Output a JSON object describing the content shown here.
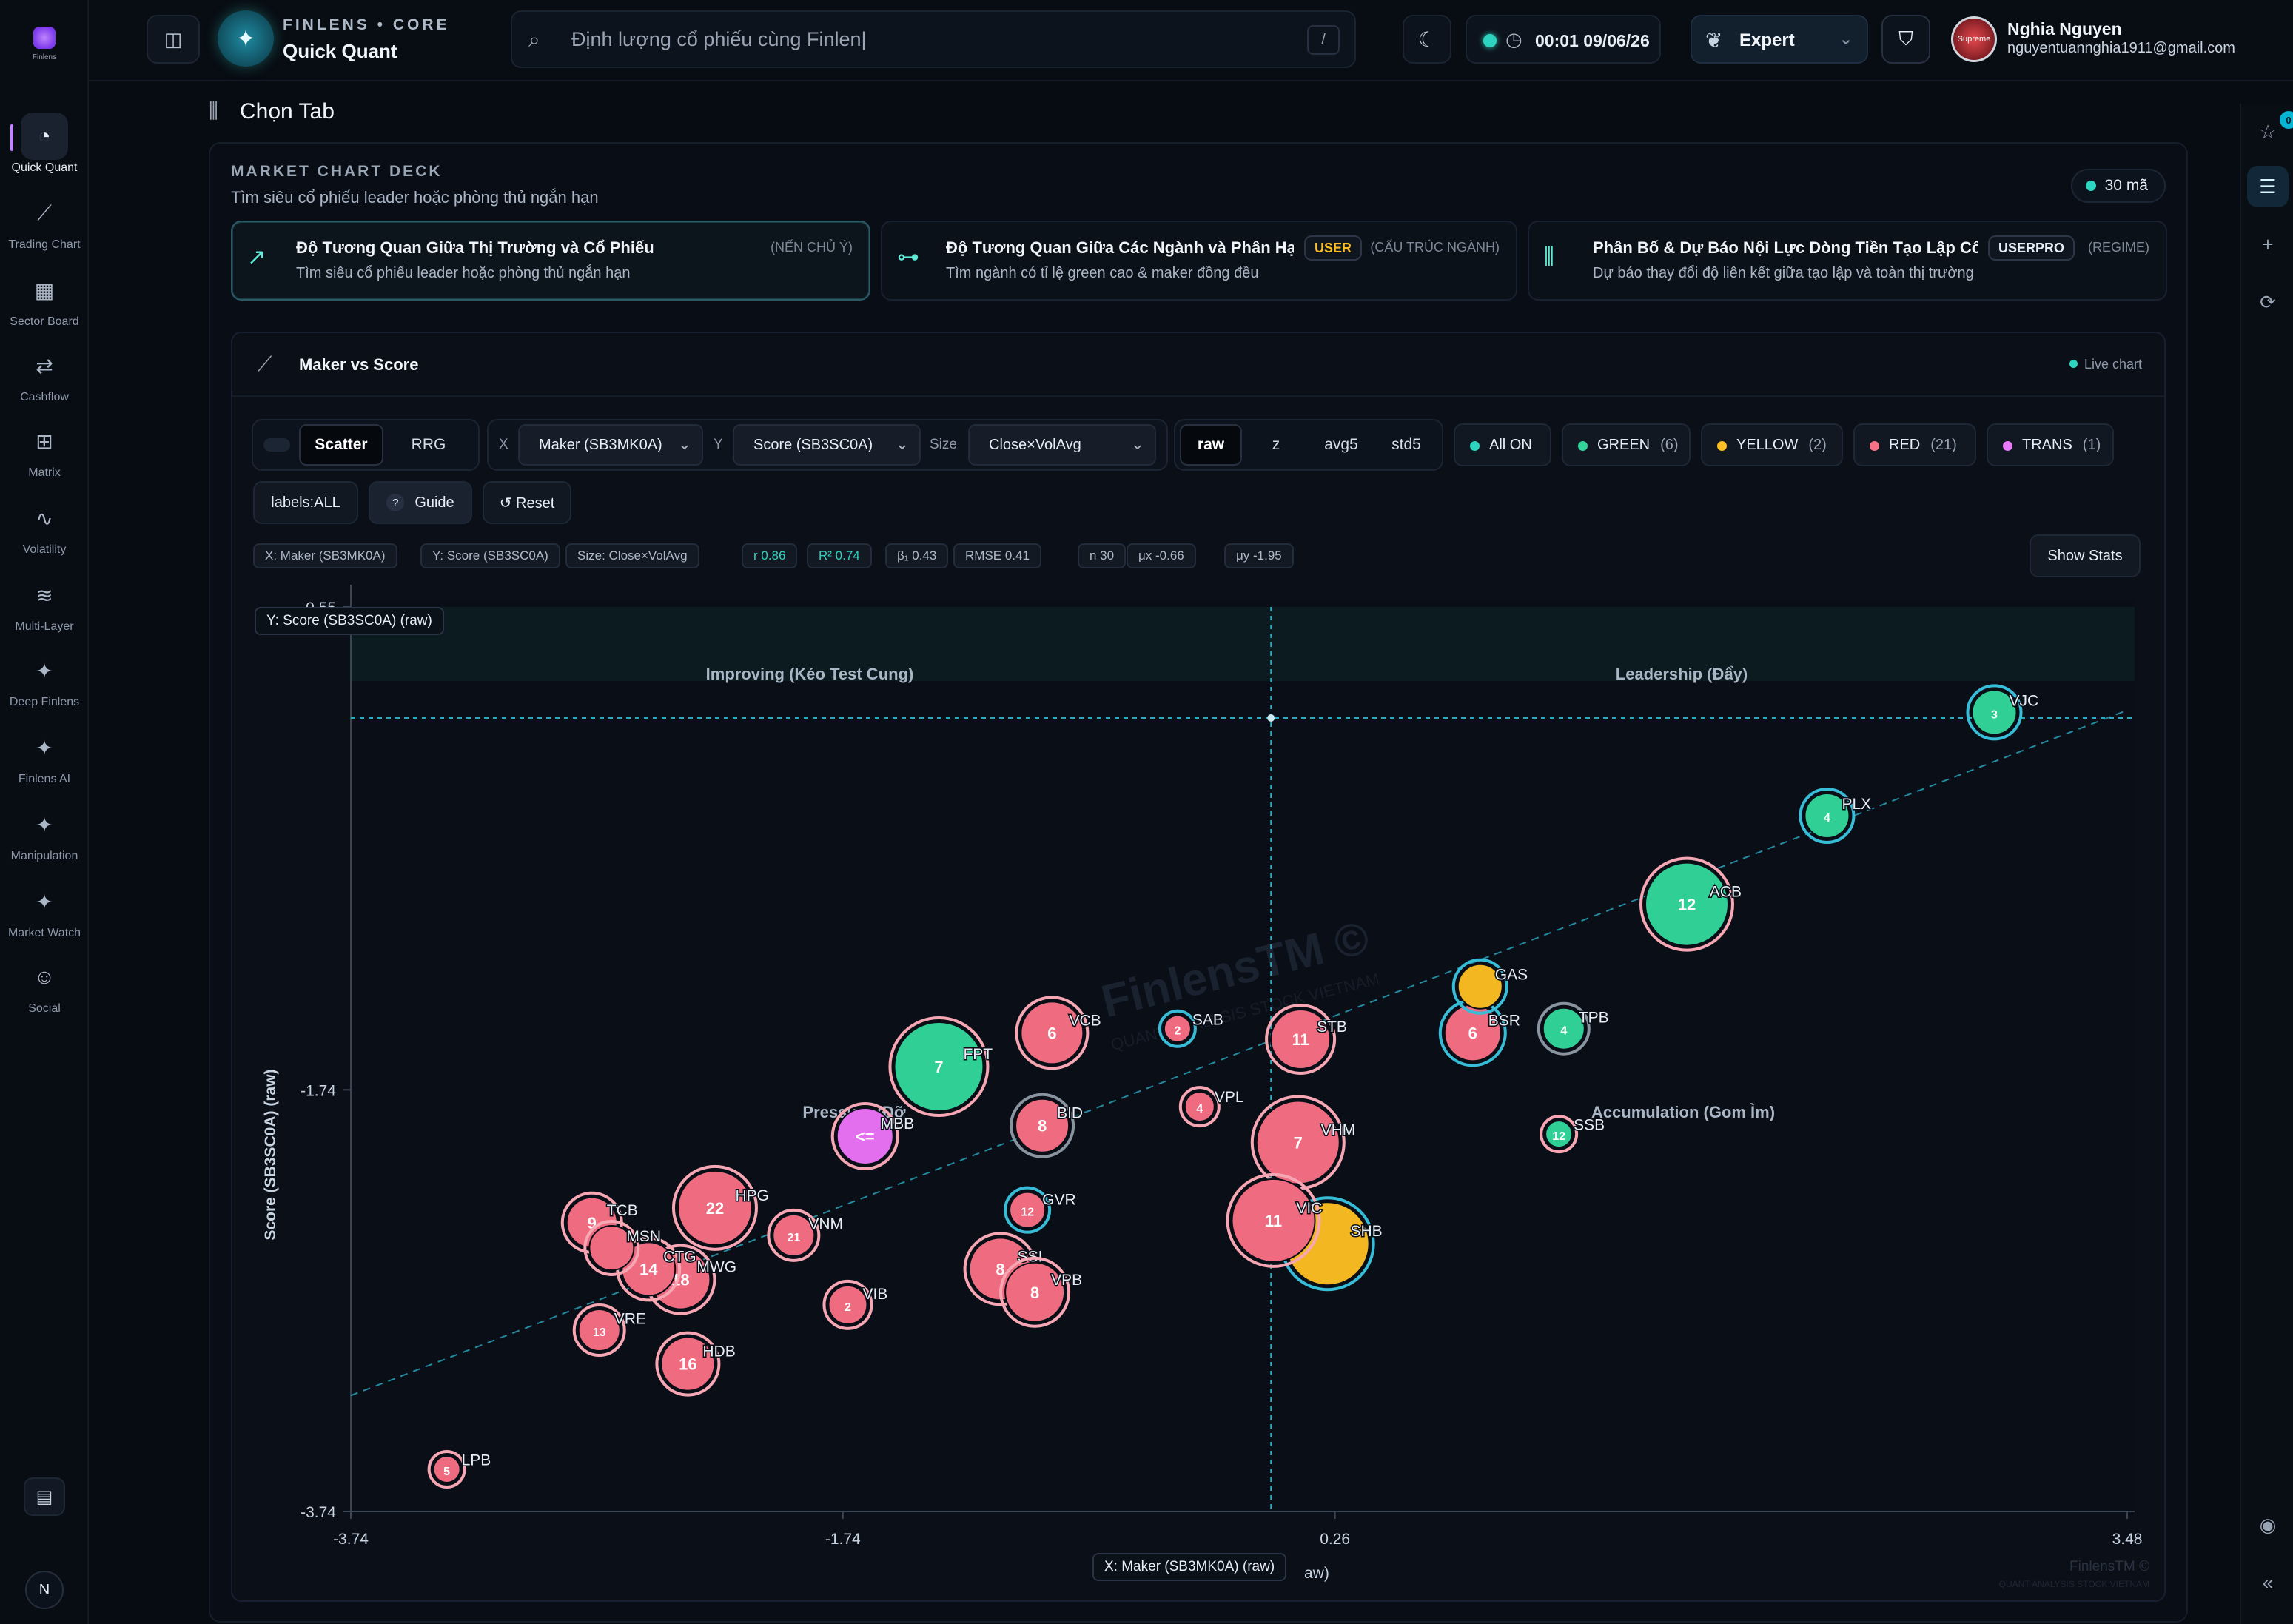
{
  "sidebar": {
    "logo_text": "Finlens",
    "items": [
      {
        "label": "Quick Quant",
        "icon": "gauge-icon",
        "glyph": "◔",
        "active": true
      },
      {
        "label": "Trading Chart",
        "icon": "line-chart-icon",
        "glyph": "⟋",
        "active": false
      },
      {
        "label": "Sector Board",
        "icon": "blocks-icon",
        "glyph": "▦",
        "active": false
      },
      {
        "label": "Cashflow",
        "icon": "arrows-swap-icon",
        "glyph": "⇄",
        "active": false
      },
      {
        "label": "Matrix",
        "icon": "grid-icon",
        "glyph": "⊞",
        "active": false
      },
      {
        "label": "Volatility",
        "icon": "pulse-icon",
        "glyph": "∿",
        "active": false
      },
      {
        "label": "Multi-Layer",
        "icon": "layers-icon",
        "glyph": "≋",
        "active": false
      },
      {
        "label": "Deep Finlens",
        "icon": "sparkles-icon",
        "glyph": "✦",
        "active": false
      },
      {
        "label": "Finlens AI",
        "icon": "sparkles-icon",
        "glyph": "✦",
        "active": false
      },
      {
        "label": "Manipulation",
        "icon": "sparkles-icon",
        "glyph": "✦",
        "active": false
      },
      {
        "label": "Market Watch",
        "icon": "sparkles-icon",
        "glyph": "✦",
        "active": false
      },
      {
        "label": "Social",
        "icon": "users-icon",
        "glyph": "☺",
        "active": false
      }
    ],
    "book_glyph": "▤",
    "user_initial": "N"
  },
  "topbar": {
    "brand_top": "FINLENS • CORE",
    "brand_name": "Quick Quant",
    "search_value": "Định lượng cổ phiếu cùng Finlen|",
    "search_shortcut": "/",
    "time": "00:01 09/06/26",
    "mode": "Expert",
    "user_name": "Nghia Nguyen",
    "user_email": "nguyentuannghia1911@gmail.com",
    "avatar_text": "Supreme"
  },
  "rail": {
    "badge": "0"
  },
  "page": {
    "heading": "Chọn Tab"
  },
  "deck": {
    "kicker": "MARKET CHART DECK",
    "subtitle": "Tìm siêu cổ phiếu leader hoặc phòng thủ ngắn hạn",
    "count": "30 mã",
    "cards": [
      {
        "title": "Độ Tương Quan Giữa Thị Trường và Cổ Phiếu",
        "desc": "Tìm siêu cổ phiếu leader hoặc phòng thủ ngắn hạn",
        "tag": "(NẾN CHỦ Ý)",
        "badge": ""
      },
      {
        "title": "Độ Tương Quan Giữa Các Ngành và Phân Hạ...",
        "desc": "Tìm ngành có tỉ lệ green cao & maker đồng đều",
        "tag": "(CẤU TRÚC NGÀNH)",
        "badge": "USER"
      },
      {
        "title": "Phân Bố & Dự Báo Nội Lực Dòng Tiền Tạo Lập Cổ ...",
        "desc": "Dự báo thay đổi độ liên kết giữa tạo lập và toàn thị trường",
        "tag": "(REGIME)",
        "badge": "USERPRO"
      }
    ]
  },
  "chart_card": {
    "title": "Maker vs Score",
    "live": "Live chart",
    "mode_tabs": [
      "Scatter",
      "RRG"
    ],
    "x_label": "X",
    "x_select": "Maker (SB3MK0A)",
    "y_label": "Y",
    "y_select": "Score (SB3SC0A)",
    "size_label": "Size",
    "size_select": "Close×VolAvg",
    "transforms": [
      "raw",
      "z",
      "avg5",
      "std5"
    ],
    "filters": [
      {
        "label": "All ON",
        "count": "",
        "color": "#2dd4bf"
      },
      {
        "label": "GREEN",
        "count": "(6)",
        "color": "#34d399"
      },
      {
        "label": "YELLOW",
        "count": "(2)",
        "color": "#fbbf24"
      },
      {
        "label": "RED",
        "count": "(21)",
        "color": "#f87185"
      },
      {
        "label": "TRANS",
        "count": "(1)",
        "color": "#e879f9"
      }
    ],
    "labels_btn": "labels:ALL",
    "guide_btn": "Guide",
    "guide_icon": "?",
    "reset_btn": "↺ Reset",
    "stats_chips": [
      {
        "text": "X: Maker (SB3MK0A)",
        "teal": false
      },
      {
        "text": "Y: Score (SB3SC0A)",
        "teal": false
      },
      {
        "text": "Size: Close×VolAvg",
        "teal": false
      },
      {
        "text": "r 0.86",
        "teal": true
      },
      {
        "text": "R² 0.74",
        "teal": true
      },
      {
        "text": "β₁ 0.43",
        "teal": false
      },
      {
        "text": "RMSE 0.41",
        "teal": false
      },
      {
        "text": "n 30",
        "teal": false
      },
      {
        "text": "μx -0.66",
        "teal": false
      },
      {
        "text": "μy -1.95",
        "teal": false
      }
    ],
    "show_stats": "Show Stats",
    "y_badge": "Y: Score (SB3SC0A) (raw)",
    "x_badge": "X: Maker (SB3MK0A) (raw)",
    "x_axis_tail": "aw)",
    "watermark_line1": "FinlensTM ©",
    "watermark_line2": "QUANT ANALYSIS STOCK VIETNAM"
  },
  "chart_data": {
    "type": "scatter",
    "title": "Maker vs Score",
    "xlabel": "X: Maker (SB3MK0A) (raw)",
    "ylabel": "Score (SB3SC0A) (raw)",
    "xlim": [
      -3.74,
      3.48
    ],
    "ylim": [
      -3.74,
      0.55
    ],
    "x_ticks": [
      "-3.74",
      "-1.74",
      "0.26",
      "3.48"
    ],
    "y_ticks": [
      "0.55",
      "-1.74",
      "-3.74"
    ],
    "split_x": -0.0,
    "split_y": 0.0,
    "quadrants": [
      "Improving (Kéo Test Cung)",
      "Leadership (Đẩy)",
      "Pressure (Đỡ",
      "Accumulation (Gom Ìm)"
    ],
    "colors": {
      "GREEN": "#2fcf96",
      "YELLOW": "#f2b721",
      "RED": "#ee6b80",
      "TRANS": "#e46fee"
    },
    "rings": {
      "teal": "#38bdd8",
      "grey": "#8a93a0",
      "pink": "#f7a6b3"
    },
    "regression": {
      "x": [
        -3.74,
        3.48
      ],
      "y": [
        -3.19,
        0.06
      ]
    },
    "points": [
      {
        "t": "VJC",
        "x": 2.94,
        "y": 0.05,
        "n": "3",
        "c": "GREEN",
        "ring": "teal",
        "r": 30
      },
      {
        "t": "PLX",
        "x": 2.26,
        "y": -0.44,
        "n": "4",
        "c": "GREEN",
        "ring": "teal",
        "r": 30
      },
      {
        "t": "ACB",
        "x": 1.69,
        "y": -0.86,
        "n": "12",
        "c": "GREEN",
        "ring": "pink",
        "r": 56
      },
      {
        "t": "GAS",
        "x": 0.85,
        "y": -1.25,
        "n": "",
        "c": "YELLOW",
        "ring": "teal",
        "r": 30
      },
      {
        "t": "SAB",
        "x": -0.38,
        "y": -1.45,
        "n": "2",
        "c": "RED",
        "ring": "teal",
        "r": 18
      },
      {
        "t": "TPB",
        "x": 1.19,
        "y": -1.45,
        "n": "4",
        "c": "GREEN",
        "ring": "grey",
        "r": 28
      },
      {
        "t": "VCB",
        "x": -0.89,
        "y": -1.47,
        "n": "6",
        "c": "RED",
        "ring": "pink",
        "r": 42
      },
      {
        "t": "STB",
        "x": 0.12,
        "y": -1.5,
        "n": "11",
        "c": "RED",
        "ring": "pink",
        "r": 40
      },
      {
        "t": "BSR",
        "x": 0.82,
        "y": -1.47,
        "n": "6",
        "c": "RED",
        "ring": "teal",
        "r": 38
      },
      {
        "t": "FPT",
        "x": -1.35,
        "y": -1.63,
        "n": "7",
        "c": "GREEN",
        "ring": "pink",
        "r": 60
      },
      {
        "t": "VPL",
        "x": -0.29,
        "y": -1.82,
        "n": "4",
        "c": "RED",
        "ring": "pink",
        "r": 20
      },
      {
        "t": "VHM",
        "x": 0.11,
        "y": -1.99,
        "n": "7",
        "c": "RED",
        "ring": "pink",
        "r": 56
      },
      {
        "t": "SSB",
        "x": 1.17,
        "y": -1.95,
        "n": "12",
        "c": "GREEN",
        "ring": "pink",
        "r": 18
      },
      {
        "t": "MBB",
        "x": -1.65,
        "y": -1.96,
        "n": "<=",
        "c": "TRANS",
        "ring": "pink",
        "r": 38
      },
      {
        "t": "BID",
        "x": -0.93,
        "y": -1.91,
        "n": "8",
        "c": "RED",
        "ring": "grey",
        "r": 36
      },
      {
        "t": "GVR",
        "x": -0.99,
        "y": -2.31,
        "n": "12",
        "c": "RED",
        "ring": "teal",
        "r": 24
      },
      {
        "t": "SHB",
        "x": 0.23,
        "y": -2.47,
        "n": "",
        "c": "YELLOW",
        "ring": "teal",
        "r": 56
      },
      {
        "t": "VIC",
        "x": 0.01,
        "y": -2.36,
        "n": "11",
        "c": "RED",
        "ring": "pink",
        "r": 56
      },
      {
        "t": "HPG",
        "x": -2.26,
        "y": -2.3,
        "n": "22",
        "c": "RED",
        "ring": "pink",
        "r": 50
      },
      {
        "t": "VNM",
        "x": -1.94,
        "y": -2.43,
        "n": "21",
        "c": "RED",
        "ring": "pink",
        "r": 28
      },
      {
        "t": "TCB",
        "x": -2.76,
        "y": -2.37,
        "n": "9",
        "c": "RED",
        "ring": "pink",
        "r": 34
      },
      {
        "t": "MSN",
        "x": -2.68,
        "y": -2.49,
        "n": "",
        "c": "RED",
        "ring": "pink",
        "r": 30
      },
      {
        "t": "CTG",
        "x": -2.53,
        "y": -2.59,
        "n": "14",
        "c": "RED",
        "ring": "pink",
        "r": 36
      },
      {
        "t": "MWG",
        "x": -2.4,
        "y": -2.64,
        "n": "18",
        "c": "RED",
        "ring": "pink",
        "r": 40
      },
      {
        "t": "SSI",
        "x": -1.1,
        "y": -2.59,
        "n": "8",
        "c": "RED",
        "ring": "pink",
        "r": 42
      },
      {
        "t": "VPB",
        "x": -0.96,
        "y": -2.7,
        "n": "8",
        "c": "RED",
        "ring": "pink",
        "r": 40
      },
      {
        "t": "VIB",
        "x": -1.72,
        "y": -2.76,
        "n": "2",
        "c": "RED",
        "ring": "pink",
        "r": 26
      },
      {
        "t": "VRE",
        "x": -2.73,
        "y": -2.88,
        "n": "13",
        "c": "RED",
        "ring": "pink",
        "r": 28
      },
      {
        "t": "HDB",
        "x": -2.37,
        "y": -3.04,
        "n": "16",
        "c": "RED",
        "ring": "pink",
        "r": 36
      },
      {
        "t": "LPB",
        "x": -3.35,
        "y": -3.54,
        "n": "5",
        "c": "RED",
        "ring": "pink",
        "r": 18
      }
    ]
  }
}
